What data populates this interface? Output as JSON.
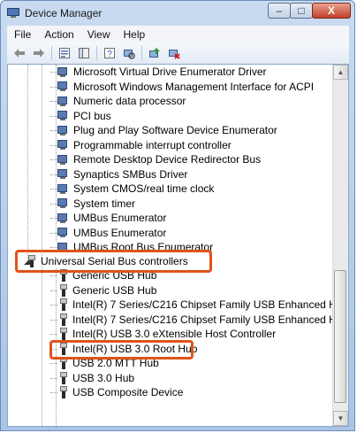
{
  "window": {
    "title": "Device Manager",
    "min_glyph": "–",
    "max_glyph": "□",
    "close_glyph": "X"
  },
  "menu": [
    "File",
    "Action",
    "View",
    "Help"
  ],
  "toolbar": [
    "back-arrow-icon",
    "forward-arrow-icon",
    "properties-icon",
    "show-hide-console-tree-icon",
    "help-icon",
    "scan-hardware-icon",
    "update-driver-icon",
    "uninstall-icon"
  ],
  "system_devices": [
    "Microsoft Virtual Drive Enumerator Driver",
    "Microsoft Windows Management Interface for ACPI",
    "Numeric data processor",
    "PCI bus",
    "Plug and Play Software Device Enumerator",
    "Programmable interrupt controller",
    "Remote Desktop Device Redirector Bus",
    "Synaptics SMBus Driver",
    "System CMOS/real time clock",
    "System timer",
    "UMBus Enumerator",
    "UMBus Enumerator",
    "UMBus Root Bus Enumerator"
  ],
  "usb_category": {
    "label": "Universal Serial Bus controllers",
    "expander_glyph": "◢"
  },
  "usb_devices": [
    "Generic USB Hub",
    "Generic USB Hub",
    "Intel(R) 7 Series/C216 Chipset Family USB Enhanced Host Co",
    "Intel(R) 7 Series/C216 Chipset Family USB Enhanced Host Co",
    "Intel(R) USB 3.0 eXtensible Host Controller",
    "Intel(R) USB 3.0 Root Hub",
    "USB 2.0 MTT Hub",
    "USB 3.0 Hub",
    "USB Composite Device"
  ],
  "highlight": {
    "color": "#e0531a",
    "usb_device_index": 5
  }
}
